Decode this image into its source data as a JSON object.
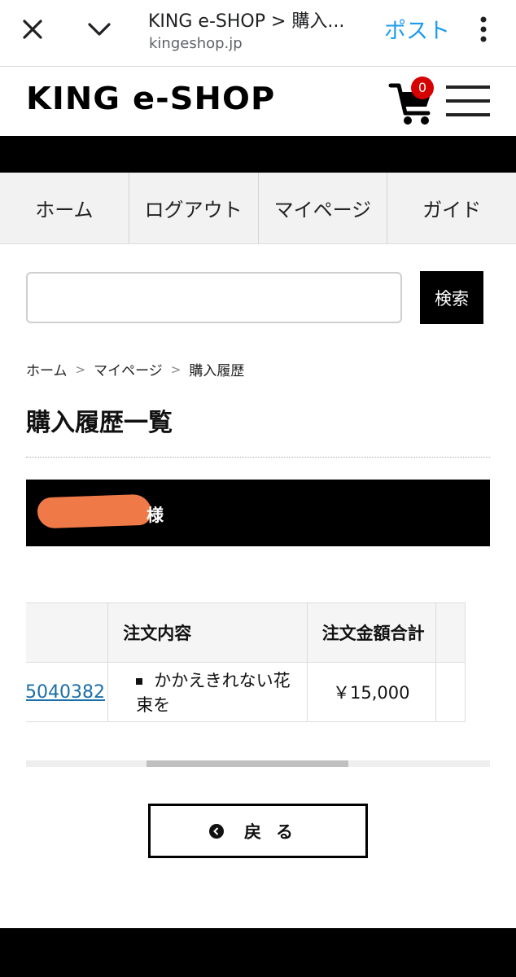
{
  "browser": {
    "title": "KING e-SHOP > 購入...",
    "url": "kingeshop.jp",
    "post_label": "ポスト"
  },
  "header": {
    "logo": "KING e-SHOP",
    "cart_count": "0",
    "badge_color": "#d60000"
  },
  "nav": {
    "items": [
      {
        "label": "ホーム"
      },
      {
        "label": "ログアウト"
      },
      {
        "label": "マイページ"
      },
      {
        "label": "ガイド"
      }
    ]
  },
  "search": {
    "value": "",
    "button_label": "検索"
  },
  "breadcrumb": {
    "items": [
      "ホーム",
      "マイページ",
      "購入履歴"
    ],
    "separator": ">"
  },
  "page_title": "購入履歴一覧",
  "user_banner": {
    "suffix": "様"
  },
  "table": {
    "headers": [
      "注文内容",
      "注文金額合計"
    ],
    "rows": [
      {
        "order_no": "5040382",
        "item": "かかえきれない花束を",
        "total": "￥15,000"
      }
    ]
  },
  "back_button": {
    "label": "戻る"
  },
  "colors": {
    "accent_blue": "#1d9bf0",
    "link": "#1b6fa8",
    "redaction": "#f07a47"
  }
}
